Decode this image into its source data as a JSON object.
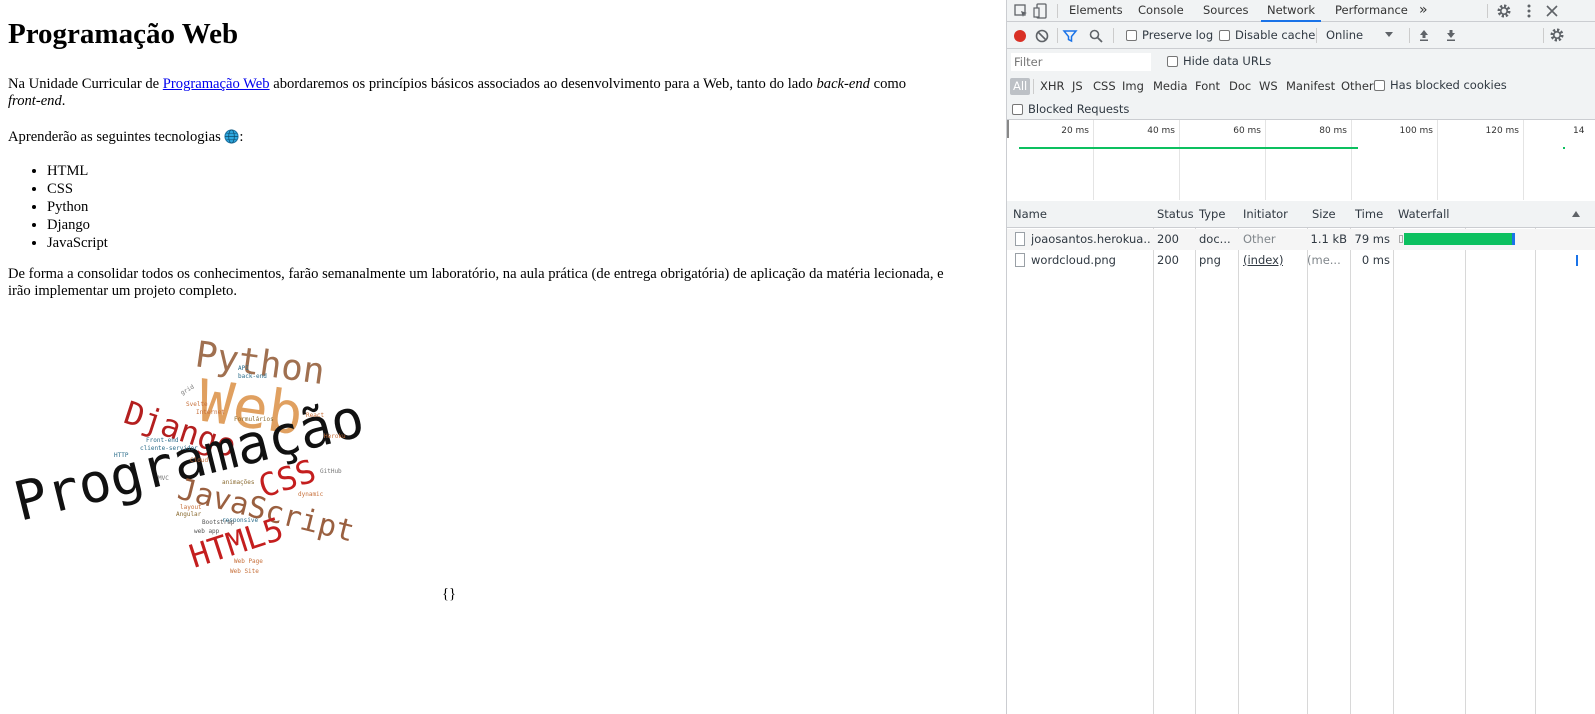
{
  "page": {
    "title": "Programação Web",
    "intro_before_link": "Na Unidade Curricular de ",
    "intro_link": "Programação Web",
    "intro_after_link": " abordaremos os princípios básicos associados ao desenvolvimento para a Web, tanto do lado ",
    "intro_em1": "back-end",
    "intro_mid": " como ",
    "intro_em2": "front-end",
    "intro_end": ".",
    "tech_intro": "Aprenderão as seguintes tecnologias ",
    "tech_colon": ":",
    "technologies": [
      "HTML",
      "CSS",
      "Python",
      "Django",
      "JavaScript"
    ],
    "closing": "De forma a consolidar todos os conhecimentos, farão semanalmente um laboratório, na aula prática (de entrega obrigatória) de aplicação da matéria lecionada, e irão implementar um projeto completo.",
    "braces": "{}",
    "wordcloud": {
      "big": [
        "Programação",
        "Web",
        "Python",
        "Django",
        "JavaScript",
        "CSS",
        "HTML5"
      ],
      "small": [
        "grid",
        "API",
        "back-end",
        "Svelte",
        "Internet",
        "Formulários",
        "React",
        "Heroku",
        "Front-end",
        "HTTP",
        "cliente-servidor",
        "Cloud",
        "MVC",
        "GitHub",
        "animações",
        "dynamic",
        "layout",
        "Angular",
        "responsive",
        "Bootstrap",
        "web app",
        "Web Page",
        "Web Site"
      ]
    }
  },
  "devtools": {
    "tabs": [
      "Elements",
      "Console",
      "Sources",
      "Network",
      "Performance"
    ],
    "active_tab": "Network",
    "more_tabs": "»",
    "toolbar": {
      "preserve_log": "Preserve log",
      "disable_cache": "Disable cache",
      "throttle": "Online"
    },
    "filter": {
      "placeholder": "Filter",
      "hide_data_urls": "Hide data URLs",
      "types": [
        "All",
        "XHR",
        "JS",
        "CSS",
        "Img",
        "Media",
        "Font",
        "Doc",
        "WS",
        "Manifest",
        "Other"
      ],
      "has_blocked_cookies": "Has blocked cookies",
      "blocked_requests": "Blocked Requests"
    },
    "overview_ticks": [
      "20 ms",
      "40 ms",
      "60 ms",
      "80 ms",
      "100 ms",
      "120 ms",
      "14"
    ],
    "columns": [
      "Name",
      "Status",
      "Type",
      "Initiator",
      "Size",
      "Time",
      "Waterfall"
    ],
    "requests": [
      {
        "name": "joaosantos.herokua...",
        "status": "200",
        "type": "doc...",
        "initiator": "Other",
        "size": "1.1 kB",
        "time": "79 ms"
      },
      {
        "name": "wordcloud.png",
        "status": "200",
        "type": "png",
        "initiator": "(index)",
        "size": "(me...",
        "time": "0 ms"
      }
    ],
    "colors": {
      "record": "#d93025",
      "accent": "#1a73e8",
      "waterfall_bar": "#0cc05f"
    }
  }
}
